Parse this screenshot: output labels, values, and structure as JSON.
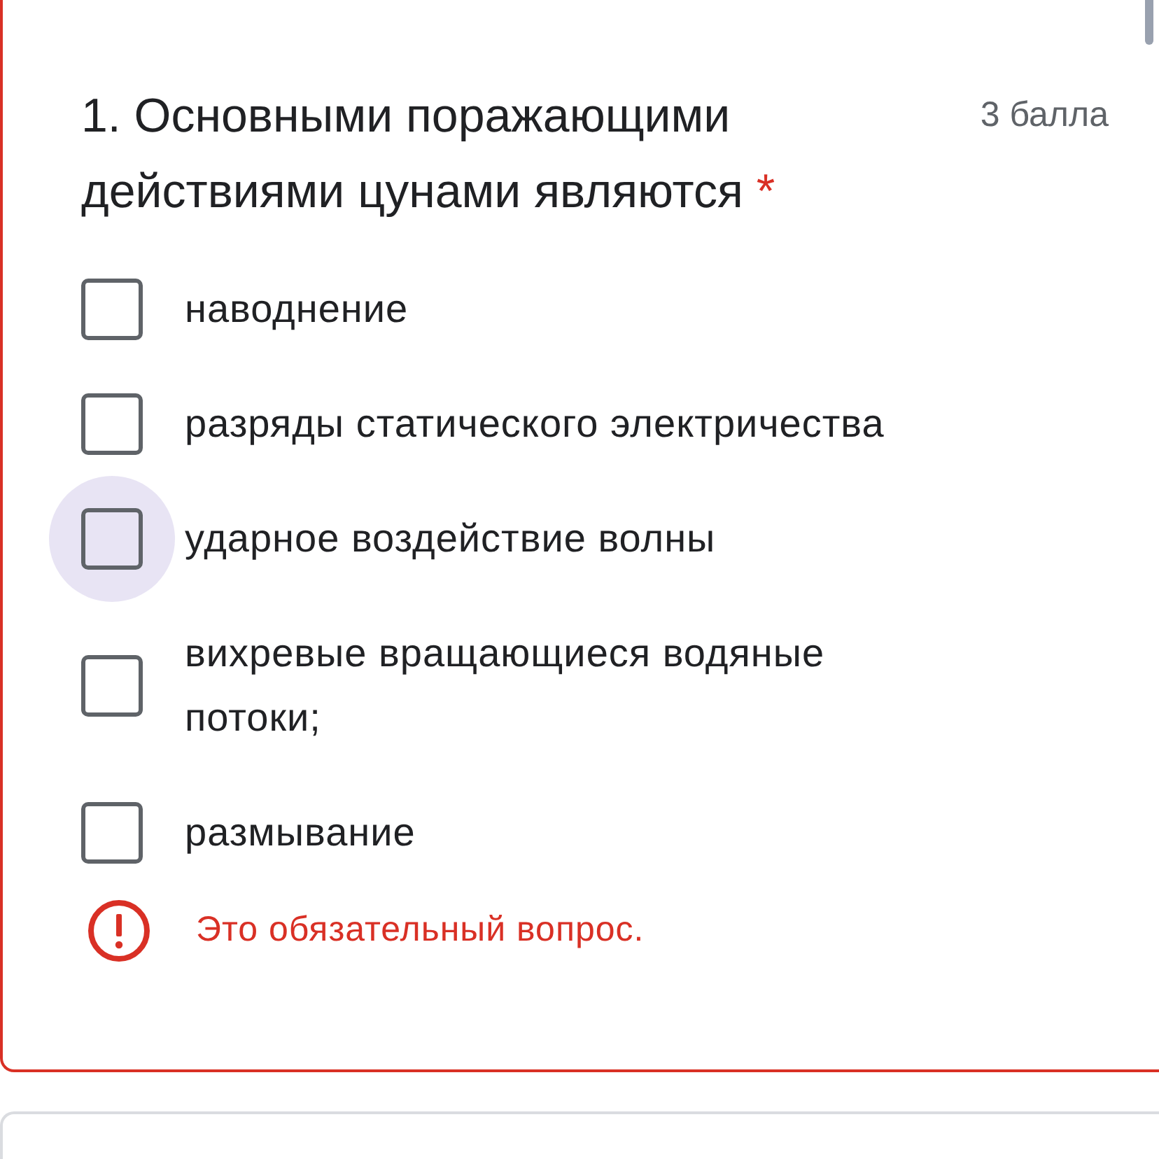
{
  "question": {
    "number": "1.",
    "title": "Основными поражающими действиями цунами являются",
    "required_mark": "*",
    "points": "3 балла",
    "required": true,
    "options": [
      {
        "label": "наводнение",
        "checked": false,
        "hovered": false
      },
      {
        "label": "разряды статического электричества",
        "checked": false,
        "hovered": false
      },
      {
        "label": "ударное воздействие волны",
        "checked": false,
        "hovered": true
      },
      {
        "label": "вихревые вращающиеся водяные потоки;",
        "checked": false,
        "hovered": false
      },
      {
        "label": "размывание",
        "checked": false,
        "hovered": false
      }
    ],
    "error": "Это обязательный вопрос."
  }
}
